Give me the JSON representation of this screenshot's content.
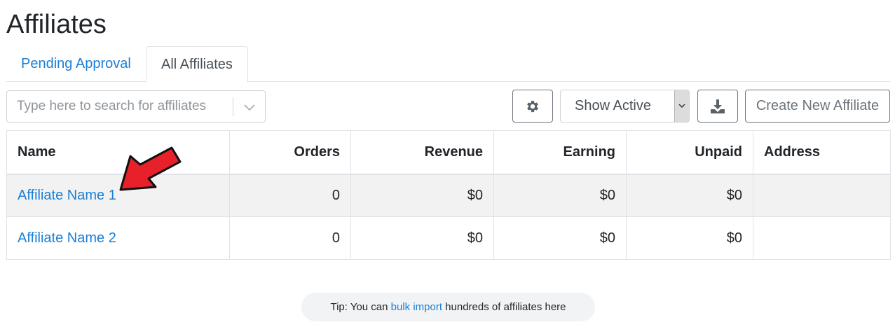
{
  "page": {
    "title": "Affiliates"
  },
  "tabs": [
    {
      "label": "Pending Approval",
      "active": false
    },
    {
      "label": "All Affiliates",
      "active": true
    }
  ],
  "toolbar": {
    "search_placeholder": "Type here to search for affiliates",
    "settings_icon": "gear-icon",
    "status_filter": "Show Active",
    "download_icon": "download-icon",
    "create_label": "Create New Affiliate"
  },
  "table": {
    "headers": [
      "Name",
      "Orders",
      "Revenue",
      "Earning",
      "Unpaid",
      "Address"
    ],
    "rows": [
      {
        "name": "Affiliate Name 1",
        "orders": "0",
        "revenue": "$0",
        "earning": "$0",
        "unpaid": "$0",
        "address": ""
      },
      {
        "name": "Affiliate Name 2",
        "orders": "0",
        "revenue": "$0",
        "earning": "$0",
        "unpaid": "$0",
        "address": ""
      }
    ]
  },
  "tip": {
    "prefix": "Tip: You can ",
    "link": "bulk import",
    "suffix": " hundreds of affiliates here"
  },
  "colors": {
    "link": "#1a7fd6",
    "highlight_row": "#f2f2f2",
    "annotation_arrow": "#e8202a"
  }
}
